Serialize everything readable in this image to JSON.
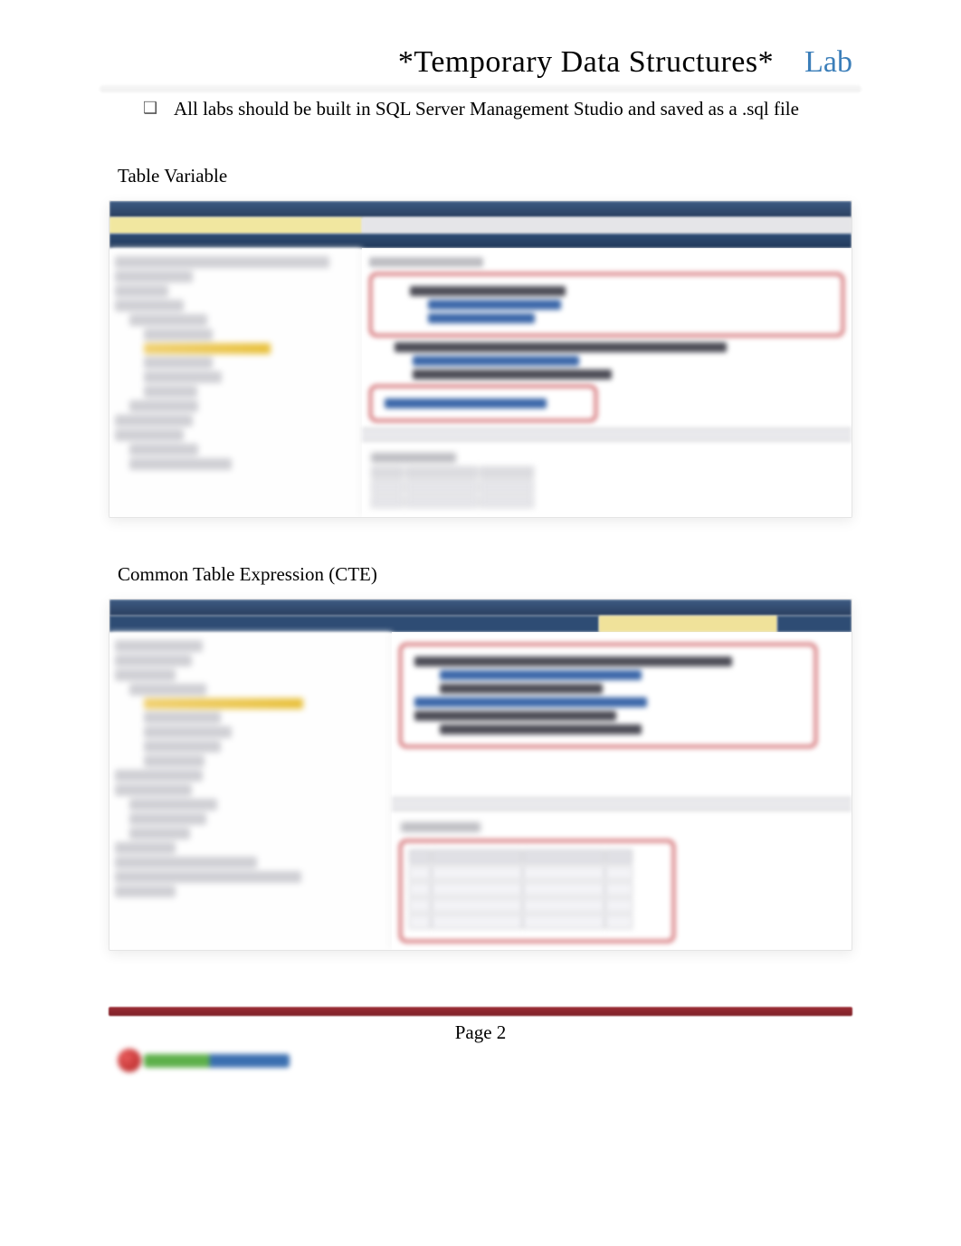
{
  "header": {
    "title": "*Temporary Data Structures*",
    "badge": "Lab"
  },
  "bullet": {
    "text": "All labs should be built in SQL Server Management Studio and saved as a .sql file"
  },
  "sections": {
    "table_variable": "Table Variable",
    "cte": "Common Table Expression (CTE)"
  },
  "footer": {
    "page": "Page 2"
  }
}
